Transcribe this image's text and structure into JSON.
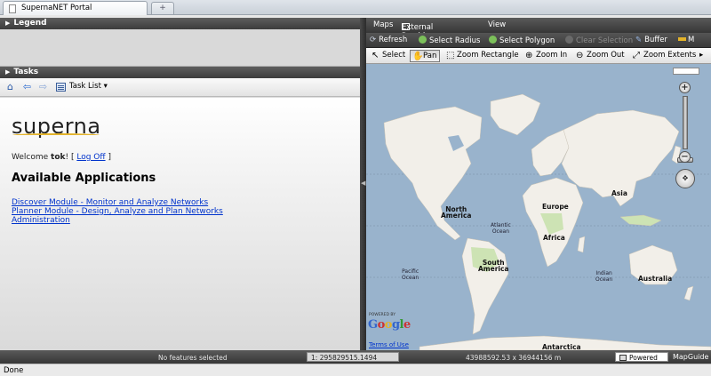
{
  "browser": {
    "tab_title": "SupernaNET Portal",
    "new_tab_label": "+",
    "status_text": "Done"
  },
  "legend": {
    "title": "Legend"
  },
  "tasks": {
    "title": "Tasks",
    "task_list_label": "Task List"
  },
  "content": {
    "logo_text": "superna",
    "welcome_prefix": "Welcome ",
    "user": "tok",
    "welcome_sep": "! [ ",
    "logoff_label": "Log Off",
    "welcome_suffix": " ]",
    "apps_title": "Available Applications",
    "apps": [
      "Discover Module - Monitor and Analyze Networks",
      "Planner Module - Design, Analyze and Plan Networks",
      "Administration"
    ]
  },
  "map": {
    "menu": [
      "Maps",
      "External Providers",
      "View"
    ],
    "toolbar1": [
      "Refresh",
      "Select Radius",
      "Select Polygon",
      "Clear Selection",
      "Buffer",
      "M"
    ],
    "toolbar2": [
      "Select",
      "Pan",
      "Zoom Rectangle",
      "Zoom In",
      "Zoom Out",
      "Zoom Extents"
    ],
    "labels": {
      "north_america": "North\nAmerica",
      "europe": "Europe",
      "asia": "Asia",
      "africa": "Africa",
      "south_america": "South\nAmerica",
      "australia": "Australia",
      "antarctica": "Antarctica",
      "atlantic": "Atlantic\nOcean",
      "pacific": "Pacific\nOcean",
      "indian": "Indian\nOcean"
    },
    "powered_by_small": "POWERED BY",
    "google": "Google",
    "terms": "Terms of Use",
    "colors": {
      "water": "#99b3cc",
      "land": "#f2efe9",
      "forest": "#cde3b4"
    }
  },
  "status": {
    "selection": "No features selected",
    "scale": "295829515.1494",
    "coords": "43988592.53 x 36944156 m",
    "powered_by": "Powered by",
    "brand": "MapGuide"
  }
}
